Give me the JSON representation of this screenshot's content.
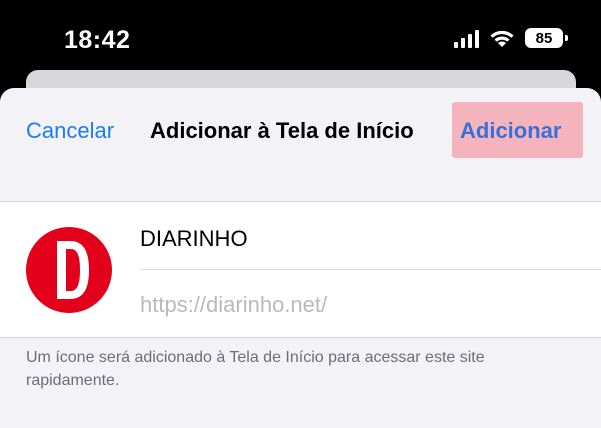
{
  "status_bar": {
    "time": "18:42",
    "battery": "85",
    "icons": [
      "cellular-signal-icon",
      "wifi-icon",
      "battery-icon"
    ]
  },
  "nav": {
    "cancel_label": "Cancelar",
    "title": "Adicionar à Tela de Início",
    "add_label": "Adicionar"
  },
  "card": {
    "icon_letter": "D",
    "name": "DIARINHO",
    "url": "https://diarinho.net/"
  },
  "footer": {
    "note": "Um ícone será adicionado à Tela de Início para acessar este site rapidamente."
  },
  "colors": {
    "accent": "#1a7cf5",
    "add_highlight": "#f5b4bd",
    "brand_red": "#e2001a"
  }
}
